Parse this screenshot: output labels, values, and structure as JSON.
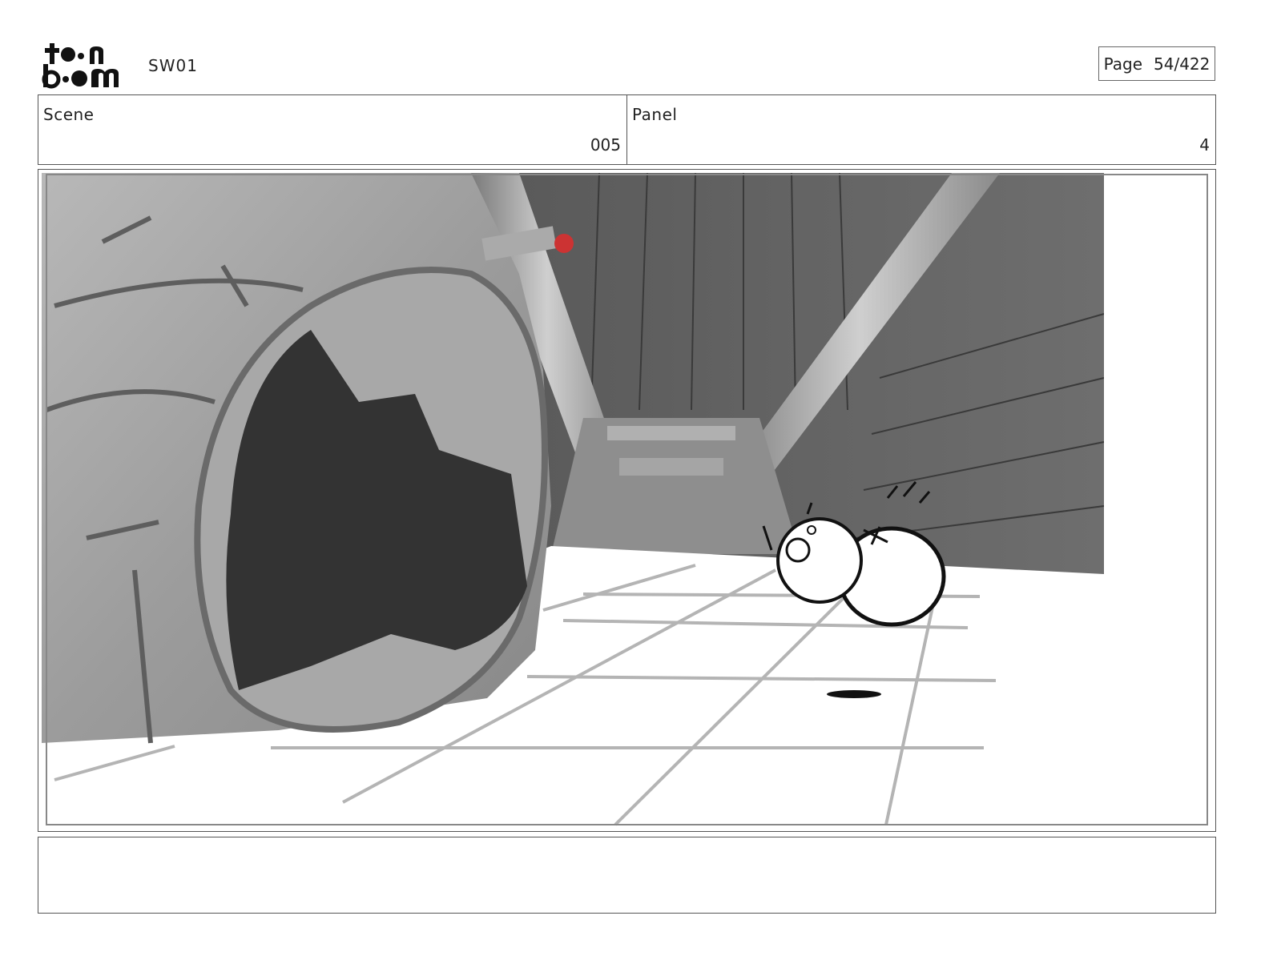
{
  "header": {
    "logo_text": "toon boom",
    "project": "SW01",
    "page_label": "Page",
    "page_value": "54/422"
  },
  "info": {
    "scene_label": "Scene",
    "scene_value": "005",
    "panel_label": "Panel",
    "panel_value": "4"
  },
  "notes": {
    "text": ""
  }
}
